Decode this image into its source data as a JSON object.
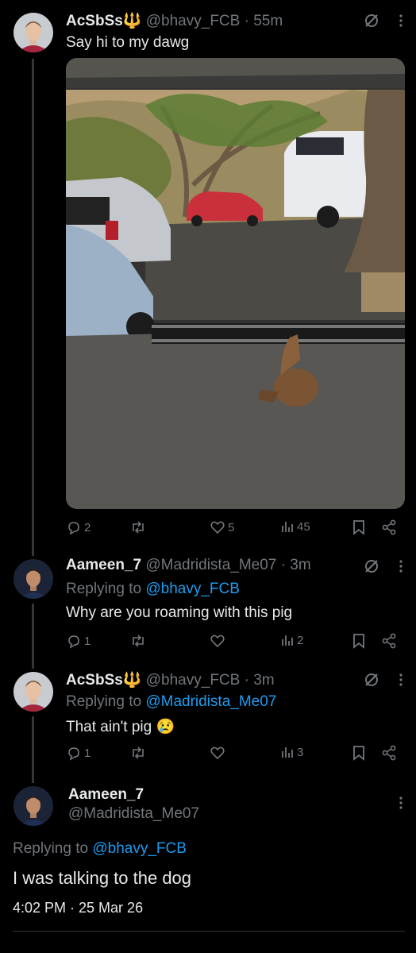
{
  "tweet1": {
    "name": "AcSbSs",
    "name_emoji": "🔱",
    "handle": "@bhavy_FCB",
    "time": "· 55m",
    "text": "Say hi to my dawg",
    "replies": "2",
    "likes": "5",
    "views": "45"
  },
  "reply1": {
    "name": "Aameen_7",
    "handle": "@Madridista_Me07",
    "time": "· 3m",
    "replying_to_label": "Replying to",
    "replying_to_handle": "@bhavy_FCB",
    "text": "Why are you roaming with this pig",
    "replies": "1",
    "views": "2"
  },
  "reply2": {
    "name": "AcSbSs",
    "name_emoji": "🔱",
    "handle": "@bhavy_FCB",
    "time": "· 3m",
    "replying_to_label": "Replying to",
    "replying_to_handle": "@Madridista_Me07",
    "text": "That ain't pig",
    "text_emoji": "😢",
    "replies": "1",
    "views": "3"
  },
  "focus": {
    "name": "Aameen_7",
    "handle": "@Madridista_Me07",
    "replying_to_label": "Replying to",
    "replying_to_handle": "@bhavy_FCB",
    "text": "I was talking to the dog",
    "timestamp": "4:02 PM · 25 Mar 26"
  },
  "colors": {
    "background": "#000000",
    "accent": "#1d9bf0",
    "secondary_text": "#71767b",
    "primary_text": "#e7e9ea"
  }
}
